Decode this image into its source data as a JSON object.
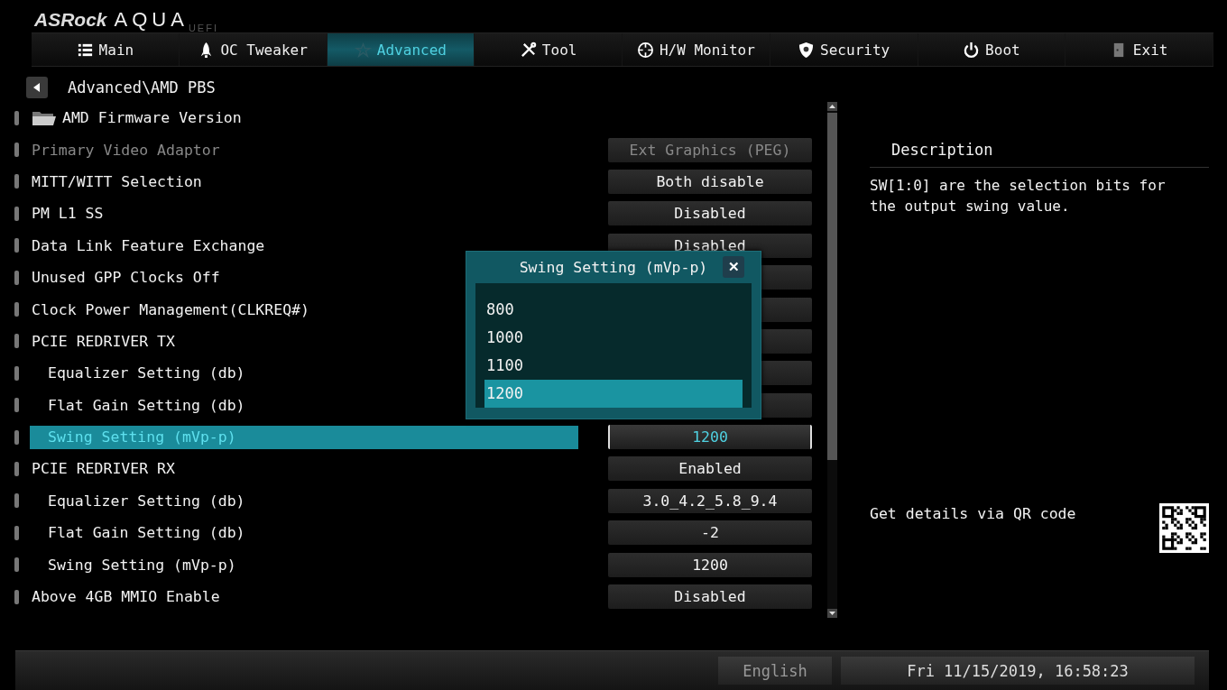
{
  "header": {
    "logo": "ASRock",
    "product": "AQUA",
    "sub": "UEFI"
  },
  "tabs": [
    {
      "label": "Main",
      "selected": false
    },
    {
      "label": "OC Tweaker",
      "selected": false
    },
    {
      "label": "Advanced",
      "selected": true
    },
    {
      "label": "Tool",
      "selected": false
    },
    {
      "label": "H/W Monitor",
      "selected": false
    },
    {
      "label": "Security",
      "selected": false
    },
    {
      "label": "Boot",
      "selected": false
    },
    {
      "label": "Exit",
      "selected": false
    }
  ],
  "breadcrumb": "Advanced\\AMD PBS",
  "settings": [
    {
      "kind": "folder",
      "label": "AMD Firmware Version",
      "indented": false,
      "disabled": false,
      "selected": false
    },
    {
      "kind": "option",
      "label": "Primary Video Adaptor",
      "value": "Ext Graphics (PEG)",
      "indented": false,
      "disabled": true,
      "selected": false
    },
    {
      "kind": "option",
      "label": "MITT/WITT Selection",
      "value": "Both disable",
      "indented": false,
      "disabled": false,
      "selected": false
    },
    {
      "kind": "option",
      "label": "PM L1 SS",
      "value": "Disabled",
      "indented": false,
      "disabled": false,
      "selected": false
    },
    {
      "kind": "option",
      "label": "Data Link Feature Exchange",
      "value": "Disabled",
      "indented": false,
      "disabled": false,
      "selected": false
    },
    {
      "kind": "option",
      "label": "Unused GPP Clocks Off",
      "indented": false,
      "disabled": false,
      "selected": false
    },
    {
      "kind": "option",
      "label": "Clock Power Management(CLKREQ#)",
      "indented": false,
      "disabled": false,
      "selected": false
    },
    {
      "kind": "option",
      "label": "PCIE REDRIVER TX",
      "indented": false,
      "disabled": false,
      "selected": false
    },
    {
      "kind": "option",
      "label": "Equalizer Setting (db)",
      "indented": true,
      "disabled": false,
      "selected": false
    },
    {
      "kind": "option",
      "label": "Flat Gain Setting (db)",
      "indented": true,
      "disabled": false,
      "selected": false
    },
    {
      "kind": "option",
      "label": "Swing Setting (mVp-p)",
      "value": "1200",
      "indented": true,
      "disabled": false,
      "selected": true
    },
    {
      "kind": "option",
      "label": "PCIE REDRIVER RX",
      "value": "Enabled",
      "indented": false,
      "disabled": false,
      "selected": false
    },
    {
      "kind": "option",
      "label": "Equalizer Setting (db)",
      "value": "3.0_4.2_5.8_9.4",
      "indented": true,
      "disabled": false,
      "selected": false
    },
    {
      "kind": "option",
      "label": "Flat Gain Setting (db)",
      "value": "-2",
      "indented": true,
      "disabled": false,
      "selected": false
    },
    {
      "kind": "option",
      "label": "Swing Setting (mVp-p)",
      "value": "1200",
      "indented": true,
      "disabled": false,
      "selected": false
    },
    {
      "kind": "option",
      "label": "Above 4GB MMIO Enable",
      "value": "Disabled",
      "indented": false,
      "disabled": false,
      "selected": false
    }
  ],
  "popup": {
    "title": "Swing Setting (mVp-p)",
    "close": "✕",
    "options": [
      {
        "label": "800",
        "selected": false
      },
      {
        "label": "1000",
        "selected": false
      },
      {
        "label": "1100",
        "selected": false
      },
      {
        "label": "1200",
        "selected": true
      }
    ]
  },
  "description": {
    "title": "Description",
    "text": "SW[1:0] are the selection bits for the output swing value.",
    "qr_hint": "Get details via QR code"
  },
  "status_bar": {
    "language": "English",
    "datetime": "Fri 11/15/2019, 16:58:23"
  }
}
